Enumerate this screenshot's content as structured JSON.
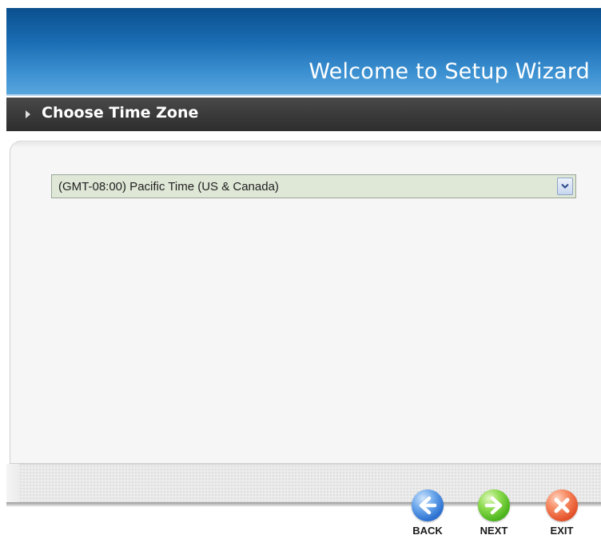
{
  "header": {
    "title": "Welcome to Setup Wizard"
  },
  "section": {
    "title": "Choose Time Zone"
  },
  "timezone_select": {
    "selected_value": "(GMT-08:00) Pacific Time (US & Canada)"
  },
  "nav": {
    "back_label": "BACK",
    "next_label": "NEXT",
    "exit_label": "EXIT"
  },
  "icons": {
    "back": "arrow-left-icon",
    "next": "arrow-right-icon",
    "exit": "close-x-icon",
    "dropdown": "chevron-down-icon",
    "section_bullet": "triangle-right-icon"
  },
  "colors": {
    "header_blue": "#1a6cb2",
    "section_bar": "#3a3a3a",
    "select_bg": "#dfe7d6",
    "back_blue": "#2f74d3",
    "next_green": "#4fb71f",
    "exit_red": "#e5552e"
  }
}
